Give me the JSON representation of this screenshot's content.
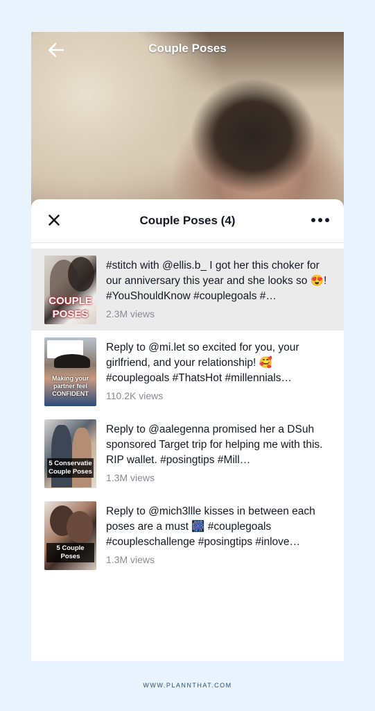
{
  "video": {
    "title": "Couple Poses"
  },
  "sheet": {
    "title": "Couple Poses (4)"
  },
  "items": [
    {
      "caption": "#stitch with @ellis.b_ I got her this choker for our anniversary this year and she looks so 😍! #YouShouldKnow #couplegoals #…",
      "views": "2.3M views",
      "thumb_text": "COUPLE POSES"
    },
    {
      "caption": "Reply to @mi.let so excited for you, your girlfriend, and your relationship! 🥰 #couplegoals #ThatsHot #millennials…",
      "views": "110.2K views",
      "thumb_text": "Making your partner feel CONFIDENT"
    },
    {
      "caption": "Reply to @aalegenna promised her a DSuh sponsored Target trip for helping me with this. RIP wallet. #posingtips #Mill…",
      "views": "1.3M views",
      "thumb_text": "5 Conservatie Couple Poses"
    },
    {
      "caption": "Reply to @mich3llle kisses in between each poses are a must 🎆 #couplegoals #coupleschallenge #posingtips #inlove…",
      "views": "1.3M views",
      "thumb_text": "5 Couple Poses"
    }
  ],
  "footer": {
    "text": "WWW.PLANNTHAT.COM"
  },
  "colors": {
    "page_bg": "#e9f3fe",
    "active_row": "#ebebeb",
    "views": "#8a8b91"
  }
}
